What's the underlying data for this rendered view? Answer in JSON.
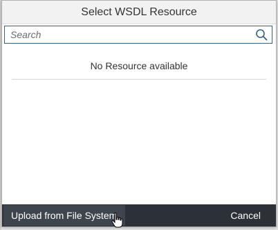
{
  "dialog": {
    "title": "Select WSDL Resource",
    "search": {
      "placeholder": "Search",
      "value": ""
    },
    "empty_message": "No Resource available",
    "footer": {
      "upload_label": "Upload from File System",
      "cancel_label": "Cancel"
    }
  },
  "icons": {
    "search": "search-icon",
    "cursor": "hand-pointer-icon"
  },
  "colors": {
    "footer_bg": "#2b3136",
    "search_border": "#346187",
    "header_bg": "#f2f2f2"
  }
}
